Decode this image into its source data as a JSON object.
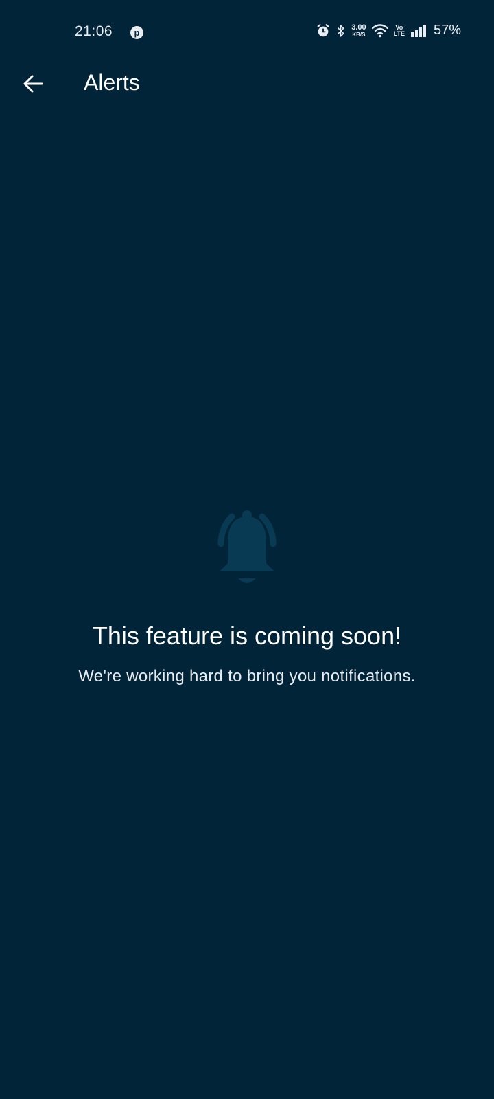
{
  "status_bar": {
    "time": "21:06",
    "pin_glyph": "p",
    "net_speed_value": "3.00",
    "net_speed_unit": "KB/S",
    "volte_top": "Vo",
    "volte_bottom": "LTE",
    "battery": "57%",
    "icons": [
      "pinterest-icon",
      "alarm-icon",
      "bluetooth-icon",
      "wifi-icon",
      "signal-icon"
    ]
  },
  "app_bar": {
    "title": "Alerts",
    "back_icon": "arrow-left-icon"
  },
  "empty_state": {
    "icon": "bell-ringing-icon",
    "title": "This feature is coming soon!",
    "subtitle": "We're working hard to bring you notifications."
  },
  "colors": {
    "background": "#022438",
    "bell": "#083a54",
    "text": "#ffffff"
  }
}
